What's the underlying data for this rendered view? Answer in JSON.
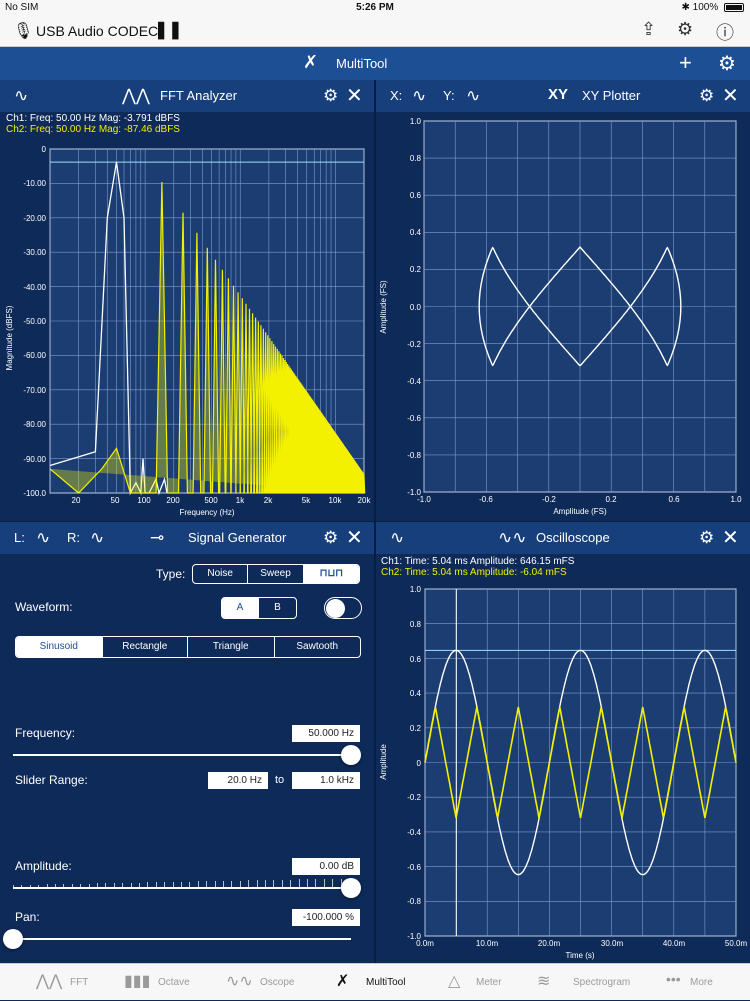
{
  "status_bar": {
    "carrier": "No SIM",
    "time": "5:26 PM",
    "battery": "100%"
  },
  "nav": {
    "device": "USB Audio CODEC"
  },
  "toolbar": {
    "title": "MultiTool"
  },
  "fft": {
    "title": "FFT Analyzer",
    "ch1_readout": "Ch1:  Freq: 50.00 Hz   Mag: -3.791 dBFS",
    "ch2_readout": "Ch2:  Freq: 50.00 Hz   Mag: -87.46 dBFS",
    "ylabel": "Magnitude (dBFS)",
    "xlabel": "Frequency (Hz)",
    "y_ticks": [
      "0",
      "-10.00",
      "-20.00",
      "-30.00",
      "-40.00",
      "-50.00",
      "-60.00",
      "-70.00",
      "-80.00",
      "-90.00",
      "-100.0"
    ],
    "x_ticks": [
      "20",
      "50",
      "100",
      "200",
      "500",
      "1k",
      "2k",
      "5k",
      "10k",
      "20k"
    ]
  },
  "xy": {
    "title": "XY Plotter",
    "x_label": "X:",
    "y_label": "Y:",
    "title_icon": "XY",
    "ylabel": "Amplitude (FS)",
    "xlabel": "Amplitude (FS)",
    "y_ticks": [
      "1.0",
      "0.8",
      "0.6",
      "0.4",
      "0.2",
      "0.0",
      "-0.2",
      "-0.4",
      "-0.6",
      "-0.8",
      "-1.0"
    ],
    "x_ticks": [
      "-1.0",
      "-0.6",
      "-0.2",
      "0.2",
      "0.6",
      "1.0"
    ]
  },
  "siggen": {
    "title": "Signal Generator",
    "left_label": "L:",
    "right_label": "R:",
    "type_label": "Type:",
    "types": [
      "Noise",
      "Sweep"
    ],
    "waveform_label": "Waveform:",
    "waveform_ab": [
      "A",
      "B"
    ],
    "shapes": [
      "Sinusoid",
      "Rectangle",
      "Triangle",
      "Sawtooth"
    ],
    "frequency_label": "Frequency:",
    "frequency_value": "50.000 Hz",
    "slider_range_label": "Slider Range:",
    "range_min": "20.0 Hz",
    "range_to": "to",
    "range_max": "1.0 kHz",
    "amplitude_label": "Amplitude:",
    "amplitude_value": "0.00 dB",
    "pan_label": "Pan:",
    "pan_value": "-100.000 %",
    "frequency_slider_level": 1.0,
    "amplitude_slider_level": 1.0,
    "pan_slider_level": 0.0
  },
  "scope": {
    "title": "Oscilloscope",
    "ch1_readout": "Ch1:  Time: 5.04 ms    Amplitude: 646.15 mFS",
    "ch2_readout": "Ch2:  Time: 5.04 ms    Amplitude: -6.04 mFS",
    "ylabel": "Amplitude",
    "xlabel": "Time (s)",
    "y_ticks": [
      "1.0",
      "0.8",
      "0.6",
      "0.4",
      "0.2",
      "0",
      "-0.2",
      "-0.4",
      "-0.6",
      "-0.8",
      "-1.0"
    ],
    "x_ticks": [
      "0.0m",
      "10.0m",
      "20.0m",
      "30.0m",
      "40.0m",
      "50.0m"
    ]
  },
  "tabs": [
    {
      "label": "FFT",
      "icon": "fft-icon"
    },
    {
      "label": "Octave",
      "icon": "octave-icon"
    },
    {
      "label": "Oscope",
      "icon": "oscope-icon"
    },
    {
      "label": "MultiTool",
      "icon": "multitool-icon"
    },
    {
      "label": "Meter",
      "icon": "meter-icon"
    },
    {
      "label": "Spectrogram",
      "icon": "spectrogram-icon"
    },
    {
      "label": "More",
      "icon": "more-icon"
    }
  ],
  "colors": {
    "background": "#0e2a58",
    "header": "#163f7c",
    "toolbar": "#1d4f95",
    "ch1": "#ffffff",
    "ch2": "#f3f000"
  }
}
